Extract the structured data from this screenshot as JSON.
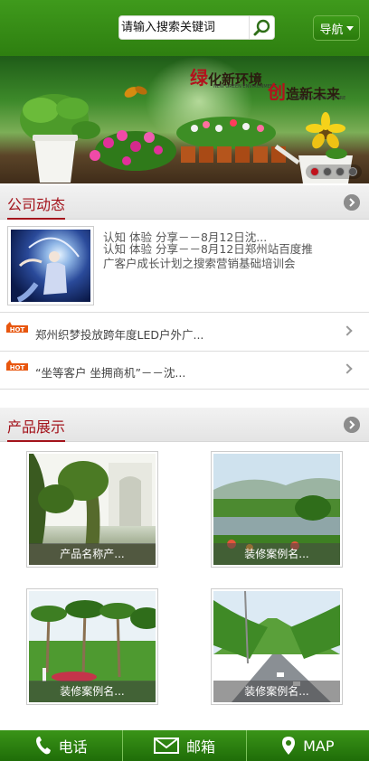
{
  "header": {
    "search_placeholder": "请输入搜索关键词",
    "nav_label": "导航"
  },
  "banner": {
    "slogan1_accent": "绿",
    "slogan1_rest": "化新环境",
    "slogan1_sub": "NEW GREEN ENVIRONMENT",
    "slogan2_accent": "创",
    "slogan2_rest": "造新未来",
    "slogan2_sub": "CREATE A NEW FUTURE",
    "slide_count": 4,
    "active_slide": 1
  },
  "news": {
    "title": "公司动态",
    "featured": {
      "title": "认知 体验 分享－－8月12日沈...",
      "desc": "认知 体验 分享－－8月12日郑州站百度推广客户成长计划之搜索营销基础培训会"
    },
    "items": [
      {
        "badge": "HOT",
        "text": "郑州织梦投放跨年度LED户外广..."
      },
      {
        "badge": "HOT",
        "text": "“坐等客户 坐拥商机”－－沈..."
      }
    ]
  },
  "products": {
    "title": "产品展示",
    "items": [
      {
        "caption": "产品名称产..."
      },
      {
        "caption": "装修案例名..."
      },
      {
        "caption": "装修案例名..."
      },
      {
        "caption": "装修案例名..."
      }
    ]
  },
  "footer": {
    "phone": "电话",
    "mail": "邮箱",
    "map": "MAP"
  },
  "colors": {
    "brand_green": "#2e7f10",
    "accent_red": "#a3131b"
  }
}
